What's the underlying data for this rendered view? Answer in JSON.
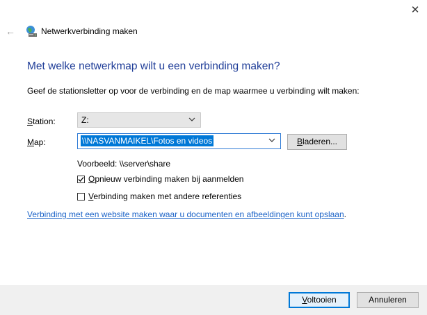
{
  "window": {
    "title": "Netwerkverbinding maken",
    "close_icon": "close-icon",
    "back_icon": "back-arrow-icon",
    "app_icon": "network-drive-icon"
  },
  "heading": "Met welke netwerkmap wilt u een verbinding maken?",
  "instruction": "Geef de stationsletter op voor de verbinding en de map waarmee u verbinding wilt maken:",
  "station": {
    "label_hotkey": "S",
    "label_rest": "tation:",
    "value": "Z:"
  },
  "folder": {
    "label_hotkey": "M",
    "label_rest": "ap:",
    "value": "\\\\NASVANMAIKEL\\Fotos en videos"
  },
  "browse_button": {
    "hotkey": "B",
    "rest": "laderen..."
  },
  "example": "Voorbeeld: \\\\server\\share",
  "reconnect": {
    "checked": true,
    "hotkey": "O",
    "rest": "pnieuw verbinding maken bij aanmelden"
  },
  "other_credentials": {
    "checked": false,
    "hotkey": "V",
    "rest": "erbinding maken met andere referenties"
  },
  "website_link": "Verbinding met een website maken waar u documenten en afbeeldingen kunt opslaan",
  "website_link_suffix": ".",
  "finish_button": {
    "hotkey": "V",
    "rest": "oltooien"
  },
  "cancel_button": "Annuleren",
  "colors": {
    "heading": "#1f3d98",
    "link": "#1a62c7",
    "selection": "#0078d7"
  }
}
